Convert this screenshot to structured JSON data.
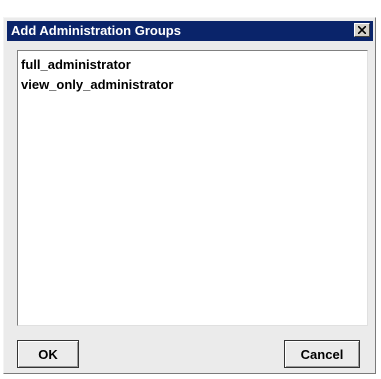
{
  "dialog": {
    "title": "Add Administration Groups",
    "close_icon": "close-icon"
  },
  "groups": [
    {
      "label": "full_administrator"
    },
    {
      "label": "view_only_administrator"
    }
  ],
  "buttons": {
    "ok_label": "OK",
    "cancel_label": "Cancel"
  },
  "colors": {
    "title_bar": "#0a246a",
    "dialog_bg": "#ebebeb",
    "list_bg": "#ffffff"
  }
}
